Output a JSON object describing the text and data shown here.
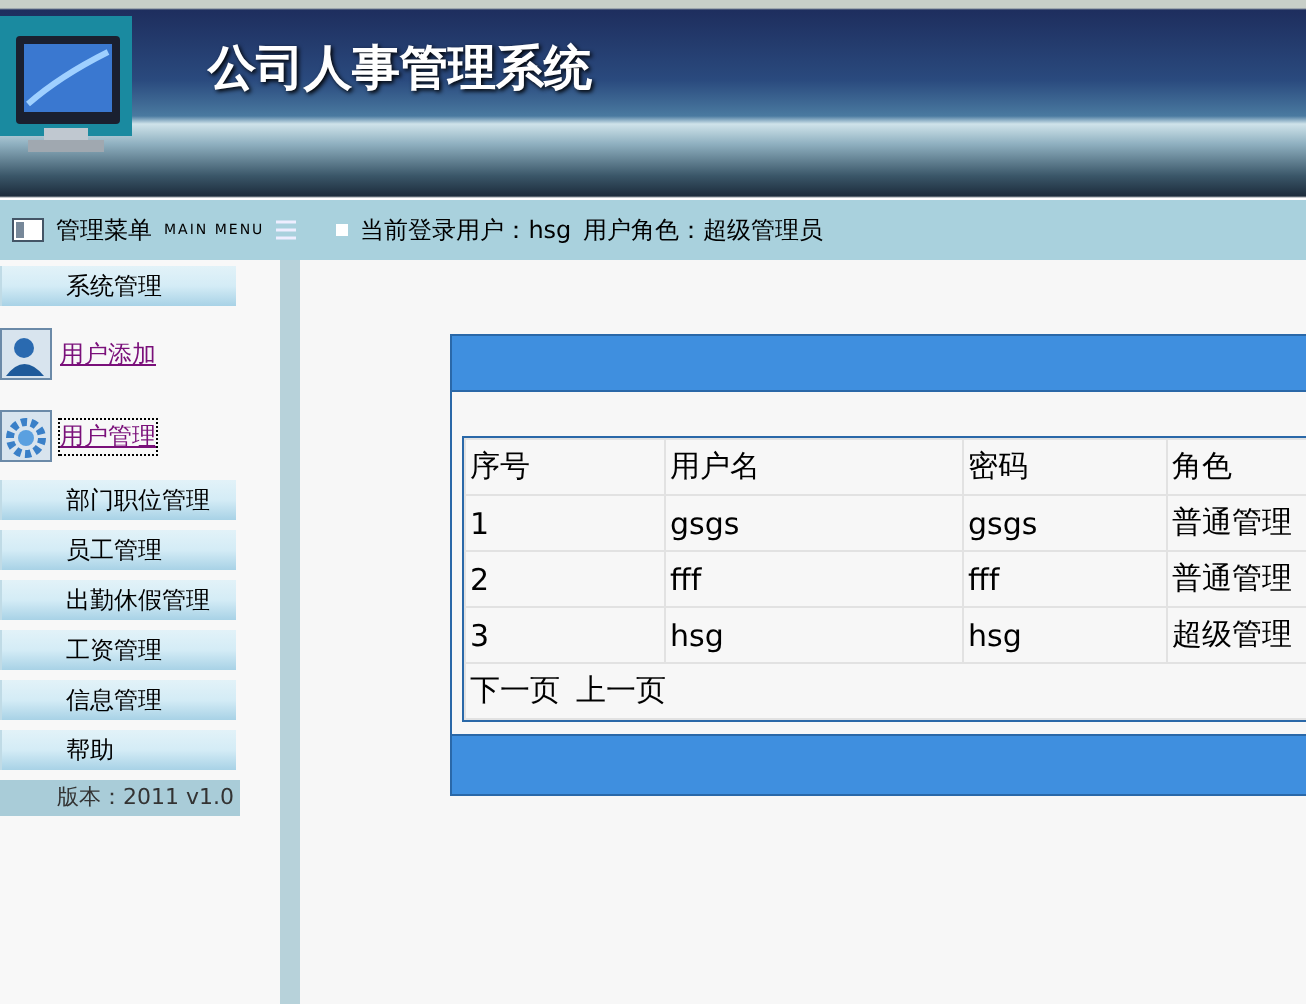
{
  "header": {
    "title": "公司人事管理系统"
  },
  "nav_bar": {
    "menu_title": "管理菜单",
    "menu_subtitle": "MAIN MENU",
    "current_user": "当前登录用户：hsg",
    "user_role": "用户角色：超级管理员"
  },
  "sidebar": {
    "items": [
      {
        "kind": "group",
        "label": "系统管理"
      },
      {
        "kind": "link",
        "label": "用户添加",
        "focused": false
      },
      {
        "kind": "link",
        "label": "用户管理",
        "focused": true
      },
      {
        "kind": "group",
        "label": "部门职位管理"
      },
      {
        "kind": "group",
        "label": "员工管理"
      },
      {
        "kind": "group",
        "label": "出勤休假管理"
      },
      {
        "kind": "group",
        "label": "工资管理"
      },
      {
        "kind": "group",
        "label": "信息管理"
      },
      {
        "kind": "group",
        "label": "帮助"
      }
    ],
    "version": "版本：2011 v1.0"
  },
  "table": {
    "columns": [
      "序号",
      "用户名",
      "密码",
      "角色"
    ],
    "rows": [
      [
        "1",
        "gsgs",
        "gsgs",
        "普通管理"
      ],
      [
        "2",
        "fff",
        "fff",
        "普通管理"
      ],
      [
        "3",
        "hsg",
        "hsg",
        "超级管理"
      ]
    ],
    "pager": [
      "下一页",
      "上一页"
    ]
  }
}
